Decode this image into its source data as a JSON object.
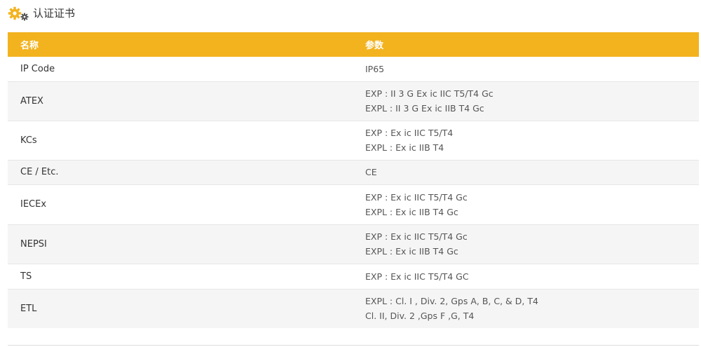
{
  "section": {
    "title": "认证证书",
    "icon": "gears-icon",
    "icon_color": "#f2b31f"
  },
  "table": {
    "header_color": "#f2b31f",
    "headers": [
      "名称",
      "参数"
    ],
    "rows": [
      {
        "name": "IP Code",
        "params": [
          "IP65"
        ]
      },
      {
        "name": "ATEX",
        "params": [
          "EXP : II 3 G Ex ic IIC T5/T4 Gc",
          "EXPL : II 3 G Ex ic IIB T4 Gc"
        ]
      },
      {
        "name": "KCs",
        "params": [
          "EXP : Ex ic IIC T5/T4",
          "EXPL : Ex ic IIB T4"
        ]
      },
      {
        "name": "CE / Etc.",
        "params": [
          "CE"
        ]
      },
      {
        "name": "IECEx",
        "params": [
          "EXP : Ex ic IIC T5/T4 Gc",
          "EXPL : Ex ic IIB T4 Gc"
        ]
      },
      {
        "name": "NEPSI",
        "params": [
          "EXP : Ex ic IIC T5/T4 Gc",
          "EXPL : Ex ic IIB T4 Gc"
        ]
      },
      {
        "name": "TS",
        "params": [
          "EXP : Ex ic IIC T5/T4 GC"
        ]
      },
      {
        "name": "ETL",
        "params": [
          "EXPL : Cl. Ⅰ , Div. 2, Gps A, B, C, & D, T4",
          "Cl. II, Div. 2 ,Gps F ,G, T4"
        ]
      }
    ]
  }
}
